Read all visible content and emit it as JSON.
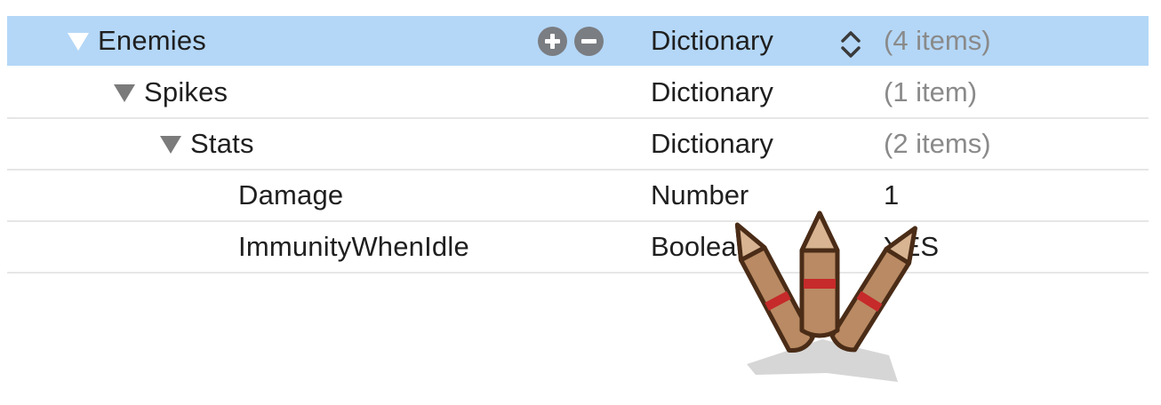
{
  "plist": {
    "rows": [
      {
        "key": "Enemies",
        "type": "Dictionary",
        "value": "(4 items)"
      },
      {
        "key": "Spikes",
        "type": "Dictionary",
        "value": "(1 item)"
      },
      {
        "key": "Stats",
        "type": "Dictionary",
        "value": "(2 items)"
      },
      {
        "key": "Damage",
        "type": "Number",
        "value": "1"
      },
      {
        "key": "ImmunityWhenIdle",
        "type": "Boolean",
        "value": "YES"
      }
    ]
  },
  "colors": {
    "selection": "#b4d7f7",
    "separator": "#e6e6e6",
    "muted_text": "#8a8a8a",
    "icon_gray": "#7a7d82"
  },
  "icons": {
    "add": "plus-circle-icon",
    "remove": "minus-circle-icon",
    "stepper": "up-down-chevron-icon",
    "disclosure": "disclosure-triangle-down-icon",
    "illustration": "wooden-spikes-icon"
  }
}
